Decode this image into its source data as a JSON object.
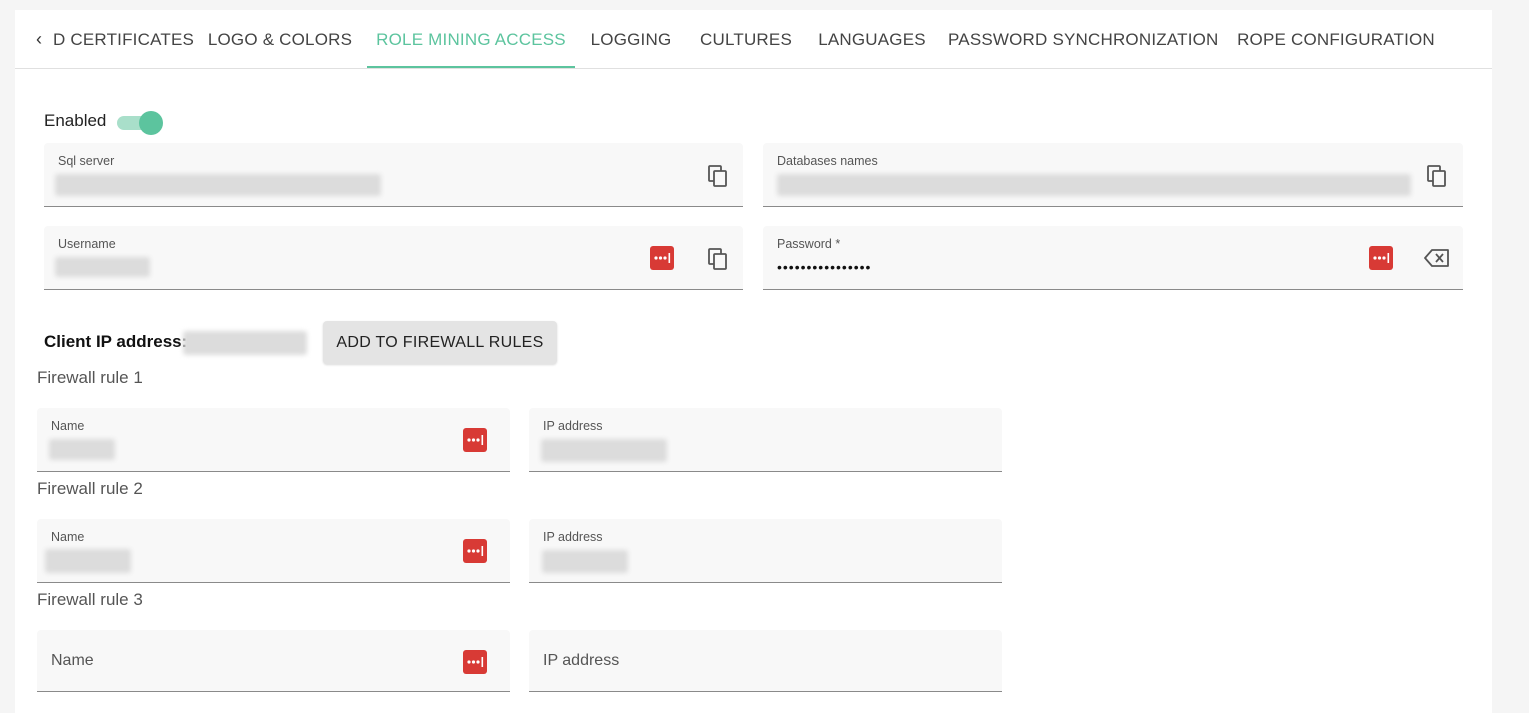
{
  "tabs": {
    "back_icon": "chevron-left-icon",
    "items": [
      {
        "label": "D CERTIFICATES",
        "active": false
      },
      {
        "label": "LOGO & COLORS",
        "active": false
      },
      {
        "label": "ROLE MINING ACCESS",
        "active": true
      },
      {
        "label": "LOGGING",
        "active": false
      },
      {
        "label": "CULTURES",
        "active": false
      },
      {
        "label": "LANGUAGES",
        "active": false
      },
      {
        "label": "PASSWORD SYNCHRONIZATION",
        "active": false
      },
      {
        "label": "ROPE CONFIGURATION",
        "active": false
      }
    ]
  },
  "enabled": {
    "label": "Enabled",
    "checked": true
  },
  "fields": {
    "sql_server": {
      "label": "Sql server"
    },
    "databases_names": {
      "label": "Databases names"
    },
    "username": {
      "label": "Username"
    },
    "password": {
      "label": "Password *",
      "value": "••••••••••••••••"
    }
  },
  "client_ip": {
    "label": "Client IP address:"
  },
  "firewall_button": {
    "label": "ADD TO FIREWALL RULES"
  },
  "firewall_rules": [
    {
      "title": "Firewall rule 1",
      "name_label": "Name",
      "ip_label": "IP address"
    },
    {
      "title": "Firewall rule 2",
      "name_label": "Name",
      "ip_label": "IP address"
    },
    {
      "title": "Firewall rule 3",
      "name_placeholder": "Name",
      "ip_placeholder": "IP address"
    }
  ],
  "colors": {
    "accent": "#5cc49e",
    "password_manager_icon": "#d83a35"
  },
  "icons": {
    "copy": "copy-icon",
    "password_manager": "password-manager-icon",
    "clear": "backspace-clear-icon"
  }
}
